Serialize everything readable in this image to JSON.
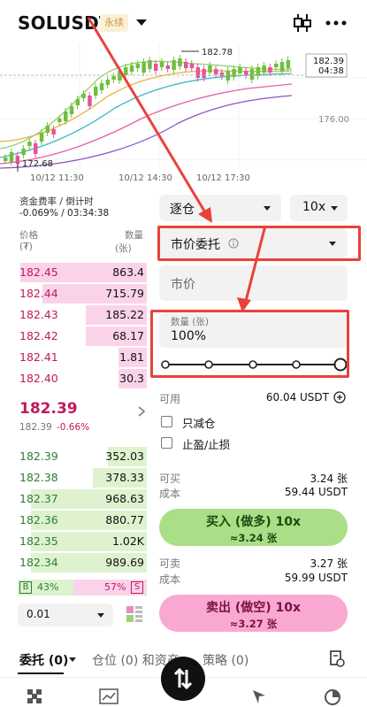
{
  "header": {
    "symbol": "SOLUSDT",
    "badge": "永续",
    "chart_icon": "candlestick-icon",
    "more_icon": "more-dots-icon"
  },
  "chart": {
    "price_labels": [
      "182.78",
      "172.68",
      "176.00",
      "182.39",
      "04:38"
    ],
    "time_labels": [
      "10/12 11:30",
      "10/12 14:30",
      "10/12 17:30"
    ]
  },
  "funding": {
    "label": "资金费率 / 倒计时",
    "value": "-0.069% / 03:34:38"
  },
  "book": {
    "price_header": "价格",
    "price_unit": "(₮)",
    "qty_header": "数量",
    "qty_unit": "(张)",
    "asks": [
      {
        "price": "182.45",
        "qty": "863.4",
        "depth": 0.98
      },
      {
        "price": "182.44",
        "qty": "715.79",
        "depth": 0.81
      },
      {
        "price": "182.43",
        "qty": "185.22",
        "depth": 0.47
      },
      {
        "price": "182.42",
        "qty": "68.17",
        "depth": 0.47
      },
      {
        "price": "182.41",
        "qty": "1.81",
        "depth": 0.22
      },
      {
        "price": "182.40",
        "qty": "30.3",
        "depth": 0.22
      }
    ],
    "last_price": "182.39",
    "mark_price": "182.39",
    "change": "-0.66%",
    "bids": [
      {
        "price": "182.39",
        "qty": "352.03",
        "depth": 0.3
      },
      {
        "price": "182.38",
        "qty": "378.33",
        "depth": 0.42
      },
      {
        "price": "182.37",
        "qty": "968.63",
        "depth": 0.9
      },
      {
        "price": "182.36",
        "qty": "880.77",
        "depth": 0.9
      },
      {
        "price": "182.35",
        "qty": "1.02K",
        "depth": 0.9
      },
      {
        "price": "182.34",
        "qty": "989.69",
        "depth": 0.9
      }
    ],
    "ratio_buy_label": "B",
    "ratio_buy": "43%",
    "ratio_sell": "57%",
    "ratio_sell_label": "S",
    "buy_fraction": 0.43,
    "precision": "0.01"
  },
  "order_form": {
    "margin_mode": "逐仓",
    "leverage": "10x",
    "order_type": "市价委托",
    "price_placeholder": "市价",
    "qty_label": "数量 (张)",
    "qty_value": "100%",
    "slider_fraction": 1.0,
    "available_label": "可用",
    "available_value": "60.04 USDT",
    "reduce_only": "只减仓",
    "tp_sl": "止盈/止损",
    "can_buy_label": "可买",
    "can_buy_value": "3.24 张",
    "cost_label_buy": "成本",
    "cost_value_buy": "59.44 USDT",
    "buy_button": "买入 (做多) 10x",
    "buy_sub": "≈3.24 张",
    "can_sell_label": "可卖",
    "can_sell_value": "3.27 张",
    "cost_label_sell": "成本",
    "cost_value_sell": "59.99 USDT",
    "sell_button": "卖出 (做空) 10x",
    "sell_sub": "≈3.27 张"
  },
  "tabs": {
    "orders": "委托 (0)",
    "positions": "仓位 (0) 和资产",
    "strategy": "策略 (0)"
  },
  "colors": {
    "ask": "#c2185b",
    "bid": "#2e7d32",
    "buy_button": "#a9df86",
    "sell_button": "#f9a9d1",
    "annotation": "#e8423a",
    "badge": "#c99a3e"
  }
}
